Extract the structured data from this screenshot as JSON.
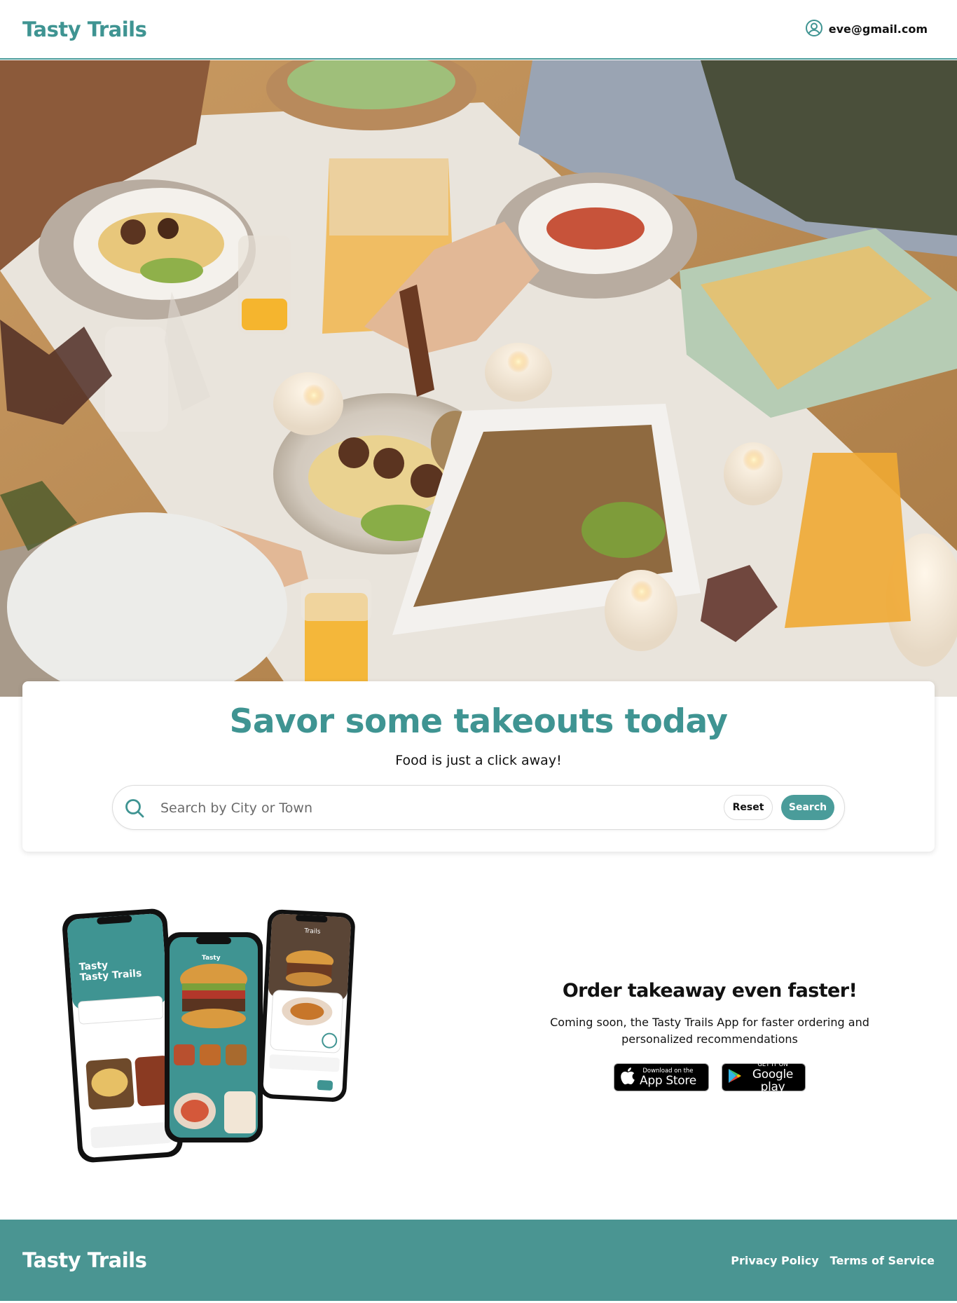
{
  "header": {
    "brand": "Tasty Trails",
    "account_email": "eve@gmail.com"
  },
  "hero_image_alt": "",
  "search_card": {
    "title": "Savor some takeouts today",
    "subtitle": "Food is just a click away!",
    "search_placeholder": "Search by City or Town",
    "search_value": "",
    "reset_label": "Reset",
    "search_label": "Search"
  },
  "promo": {
    "title": "Order takeaway even faster!",
    "body": "Coming soon, the Tasty Trails App for faster ordering and personalized recommendations",
    "app_store_small": "Download on the",
    "app_store_big": "App Store",
    "google_play_small": "GET IT ON",
    "google_play_big": "Google play",
    "phone_screens": {
      "left_title_1": "Tasty",
      "left_title_2": "Tasty Trails",
      "center_title": "Tasty",
      "right_title": "Trails"
    }
  },
  "footer": {
    "brand": "Tasty Trails",
    "privacy": "Privacy Policy",
    "terms": "Terms of Service"
  },
  "colors": {
    "brand_teal": "#3f9492",
    "footer_teal": "#4a9592",
    "button_teal": "#4a9c9a"
  },
  "icons": {
    "account": "user-circle-icon",
    "search": "search-icon",
    "apple": "apple-icon",
    "play": "google-play-icon"
  }
}
